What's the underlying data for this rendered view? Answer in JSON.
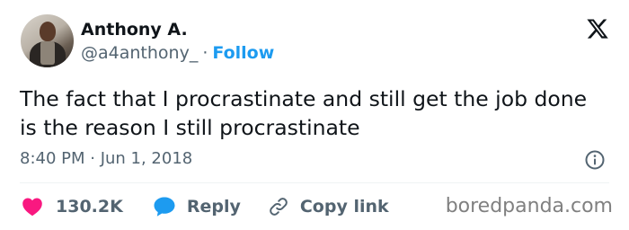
{
  "author": {
    "name": "Anthony A.",
    "handle": "@a4anthony_",
    "separator": "·",
    "follow_label": "Follow"
  },
  "tweet": {
    "text": "The fact that I procrastinate and still get the job done is the reason I still procrastinate",
    "timestamp": "8:40 PM · Jun 1, 2018"
  },
  "actions": {
    "like_count": "130.2K",
    "reply_label": "Reply",
    "copy_link_label": "Copy link"
  },
  "icons": {
    "logo": "x-logo-icon",
    "info": "info-icon",
    "like": "heart-icon",
    "reply": "reply-bubble-icon",
    "copy": "link-icon"
  },
  "colors": {
    "accent": "#1d9bf0",
    "like": "#f91880",
    "secondary_text": "#536471",
    "watermark": "#808080"
  },
  "watermark": "boredpanda.com"
}
